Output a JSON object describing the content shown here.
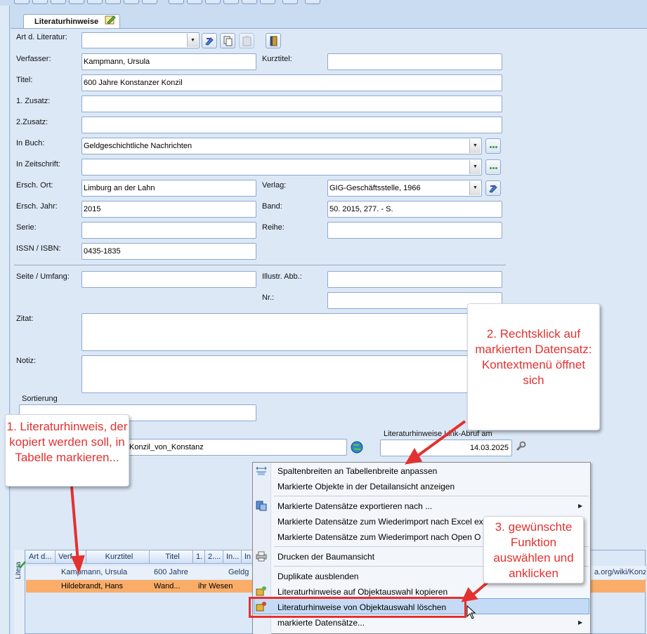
{
  "tab": {
    "title": "Literaturhinweise"
  },
  "form": {
    "labels": {
      "art": "Art d. Literatur:",
      "verfasser": "Verfasser:",
      "kurztitel": "Kurztitel:",
      "titel": "Titel:",
      "zusatz1": "1. Zusatz:",
      "zusatz2": "2.Zusatz:",
      "inbuch": "In Buch:",
      "inzeitschrift": "In Zeitschrift:",
      "erschort": "Ersch. Ort:",
      "verlag": "Verlag:",
      "erschjahr": "Ersch. Jahr:",
      "band": "Band:",
      "serie": "Serie:",
      "reihe": "Reihe:",
      "issn": "ISSN / ISBN:",
      "seite": "Seite / Umfang:",
      "illustr": "Illustr. Abb.:",
      "nr": "Nr.:",
      "zitat": "Zitat:",
      "notiz": "Notiz:",
      "sortierung": "Sortierung",
      "linkabruf": "Literaturhinweise Link-Abruf am"
    },
    "values": {
      "art": "",
      "verfasser": "Kampmann, Ursula",
      "kurztitel": "",
      "titel": "600 Jahre Konstanzer Konzil",
      "zusatz1": "",
      "zusatz2": "",
      "inbuch": "Geldgeschichtliche Nachrichten",
      "inzeitschrift": "",
      "erschort": "Limburg an der Lahn",
      "verlag": "GIG-Geschäftsstelle, 1966",
      "erschjahr": "2015",
      "band": "50. 2015, 277. - S.",
      "serie": "",
      "reihe": "",
      "issn": "0435-1835",
      "link": "Konzil_von_Konstanz",
      "linkdate": "14.03.2025"
    }
  },
  "grid": {
    "vertical_tab": "Litera",
    "headers": [
      "Art d...",
      "Verf...",
      "Kurztitel",
      "Titel",
      "1.",
      "2....",
      "In...",
      "In"
    ],
    "rows": [
      {
        "verf": "Kampmann, Ursula",
        "titel": "600 Jahre",
        "inbuch": "Geldg",
        "tail": "a.org/wiki/Konz"
      },
      {
        "verf": "Hildebrandt, Hans",
        "titel": "Wand...",
        "inbuch": "ihr Wesen"
      }
    ]
  },
  "context_menu": {
    "items": [
      "Spaltenbreiten an Tabellenbreite anpassen",
      "Markierte Objekte in der Detailansicht anzeigen",
      "Markierte Datensätze exportieren nach ...",
      "Markierte Datensätze zum Wiederimport nach Excel ex",
      "Markierte Datensätze zum Wiederimport nach Open O",
      "Drucken der Baumansicht",
      "Duplikate ausblenden",
      "Literaturhinweise auf Objektauswahl kopieren",
      "Literaturhinweise von Objektauswahl löschen",
      "markierte Datensätze..."
    ]
  },
  "callouts": {
    "step1": "1. Literaturhinweis, der kopiert werden soll, in Tabelle markieren...",
    "step2": "2. Rechtsklick auf markierten Datensatz: Kontextmenü öffnet sich",
    "step3": "3. gewünschte Funktion auswählen und anklicken"
  },
  "colors": {
    "accent_red": "#e3312f",
    "selection": "#f9ad68",
    "panel": "#dce8f6"
  }
}
